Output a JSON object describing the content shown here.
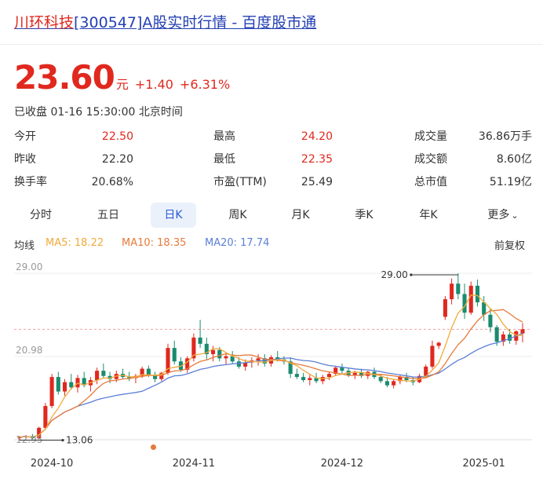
{
  "title": {
    "prefix": "川环科技",
    "code": "[300547]",
    "suffix": "A股实时行情 - 百度股市通"
  },
  "quote": {
    "price": "23.60",
    "unit": "元",
    "change": "+1.40",
    "change_pct": "+6.31%",
    "status": "已收盘 01-16 15:30:00 北京时间"
  },
  "stats": [
    {
      "label": "今开",
      "value": "22.50",
      "color": "red"
    },
    {
      "label": "最高",
      "value": "24.20",
      "color": "red"
    },
    {
      "label": "成交量",
      "value": "36.86万手",
      "color": "normal"
    },
    {
      "label": "昨收",
      "value": "22.20",
      "color": "normal"
    },
    {
      "label": "最低",
      "value": "22.35",
      "color": "red"
    },
    {
      "label": "成交额",
      "value": "8.60亿",
      "color": "normal"
    },
    {
      "label": "换手率",
      "value": "20.68%",
      "color": "normal"
    },
    {
      "label": "市盈(TTM)",
      "value": "25.49",
      "color": "normal"
    },
    {
      "label": "总市值",
      "value": "51.19亿",
      "color": "normal"
    }
  ],
  "tabs": [
    "分时",
    "五日",
    "日K",
    "周K",
    "月K",
    "季K",
    "年K",
    "更多"
  ],
  "active_tab": "日K",
  "ma": {
    "label": "均线",
    "ma5": "MA5: 18.22",
    "ma10": "MA10: 18.35",
    "ma20": "MA20: 17.74",
    "adjust": "前复权"
  },
  "colors": {
    "up": "#e0281e",
    "down": "#1a8b6e",
    "ma5": "#f2a93b",
    "ma10": "#e77a3a",
    "ma20": "#5b7fd6",
    "accent": "#2c5bd6"
  },
  "chart_data": {
    "type": "candlestick",
    "title": "",
    "y_ticks": [
      "29.00",
      "20.98",
      "12.95"
    ],
    "ylim": [
      12.95,
      29.0
    ],
    "x_ticks": [
      "2024-10",
      "2024-11",
      "2024-12",
      "2025-01"
    ],
    "max_label": "29.00",
    "min_label": "13.06",
    "last_close": 23.6,
    "candles": [
      [
        13.1,
        13.3,
        12.9,
        13.2
      ],
      [
        13.2,
        13.4,
        13.0,
        13.3
      ],
      [
        13.3,
        13.5,
        13.0,
        13.1
      ],
      [
        13.1,
        14.2,
        13.0,
        14.1
      ],
      [
        14.1,
        16.5,
        13.9,
        16.2
      ],
      [
        16.2,
        19.3,
        16.0,
        19.0
      ],
      [
        19.0,
        19.5,
        17.3,
        17.6
      ],
      [
        17.6,
        18.8,
        17.2,
        18.5
      ],
      [
        18.5,
        19.3,
        17.8,
        18.0
      ],
      [
        18.0,
        19.2,
        17.5,
        18.9
      ],
      [
        18.9,
        19.5,
        18.0,
        18.2
      ],
      [
        18.2,
        19.0,
        17.6,
        18.7
      ],
      [
        18.7,
        19.9,
        18.3,
        19.6
      ],
      [
        19.6,
        20.3,
        18.9,
        19.1
      ],
      [
        19.1,
        19.5,
        18.4,
        18.8
      ],
      [
        18.8,
        19.6,
        18.5,
        19.3
      ],
      [
        19.3,
        19.8,
        18.8,
        19.0
      ],
      [
        19.0,
        19.5,
        18.6,
        18.9
      ],
      [
        18.9,
        19.3,
        18.4,
        19.1
      ],
      [
        19.1,
        20.0,
        18.9,
        19.8
      ],
      [
        19.8,
        20.1,
        19.0,
        19.2
      ],
      [
        19.2,
        19.5,
        18.5,
        18.8
      ],
      [
        18.8,
        19.5,
        18.6,
        19.4
      ],
      [
        19.4,
        22.2,
        19.2,
        21.8
      ],
      [
        21.8,
        22.5,
        20.2,
        20.5
      ],
      [
        20.5,
        20.9,
        19.5,
        19.7
      ],
      [
        19.7,
        21.0,
        19.4,
        20.8
      ],
      [
        20.8,
        23.2,
        20.5,
        22.8
      ],
      [
        22.8,
        24.5,
        21.8,
        22.2
      ],
      [
        22.2,
        22.8,
        20.7,
        21.2
      ],
      [
        21.2,
        22.0,
        20.5,
        21.6
      ],
      [
        21.6,
        21.9,
        20.5,
        20.8
      ],
      [
        20.8,
        21.3,
        20.2,
        21.0
      ],
      [
        21.0,
        21.5,
        20.3,
        20.5
      ],
      [
        20.5,
        20.9,
        19.8,
        20.0
      ],
      [
        20.0,
        20.7,
        19.6,
        20.4
      ],
      [
        20.4,
        20.9,
        19.9,
        20.6
      ],
      [
        20.6,
        21.2,
        20.1,
        20.8
      ],
      [
        20.8,
        21.2,
        20.0,
        20.3
      ],
      [
        20.3,
        21.1,
        20.0,
        20.9
      ],
      [
        20.9,
        21.5,
        20.5,
        20.7
      ],
      [
        20.7,
        21.0,
        20.2,
        20.5
      ],
      [
        20.5,
        20.9,
        18.9,
        19.3
      ],
      [
        19.3,
        19.8,
        18.8,
        19.0
      ],
      [
        19.0,
        19.4,
        18.5,
        18.7
      ],
      [
        18.7,
        19.2,
        18.2,
        18.9
      ],
      [
        18.9,
        19.4,
        18.4,
        18.6
      ],
      [
        18.6,
        19.2,
        18.3,
        19.0
      ],
      [
        19.0,
        19.5,
        18.7,
        19.3
      ],
      [
        19.3,
        20.0,
        19.1,
        19.9
      ],
      [
        19.9,
        20.3,
        19.3,
        19.6
      ],
      [
        19.6,
        19.9,
        19.0,
        19.2
      ],
      [
        19.2,
        19.6,
        18.8,
        19.4
      ],
      [
        19.4,
        19.8,
        18.9,
        19.1
      ],
      [
        19.1,
        19.6,
        18.8,
        19.5
      ],
      [
        19.5,
        19.9,
        18.8,
        19.0
      ],
      [
        19.0,
        19.3,
        18.4,
        18.6
      ],
      [
        18.6,
        19.0,
        18.0,
        18.2
      ],
      [
        18.2,
        18.8,
        17.9,
        18.6
      ],
      [
        18.6,
        19.2,
        18.3,
        19.0
      ],
      [
        19.0,
        19.4,
        18.5,
        18.7
      ],
      [
        18.7,
        19.0,
        18.2,
        18.5
      ],
      [
        18.5,
        19.3,
        18.4,
        19.1
      ],
      [
        19.1,
        20.2,
        18.9,
        20.0
      ],
      [
        20.0,
        22.5,
        19.8,
        22.0
      ],
      [
        22.0,
        22.4,
        21.7,
        22.3
      ],
      [
        24.8,
        26.8,
        24.5,
        26.5
      ],
      [
        26.5,
        28.5,
        26.0,
        28.0
      ],
      [
        28.0,
        29.0,
        26.5,
        27.0
      ],
      [
        27.0,
        28.0,
        24.6,
        25.2
      ],
      [
        25.2,
        28.2,
        25.0,
        27.8
      ],
      [
        27.8,
        28.4,
        25.8,
        26.2
      ],
      [
        26.2,
        26.8,
        24.4,
        25.0
      ],
      [
        25.0,
        25.6,
        23.3,
        23.8
      ],
      [
        23.8,
        24.0,
        22.0,
        22.4
      ],
      [
        22.4,
        23.4,
        22.0,
        23.1
      ],
      [
        23.1,
        23.6,
        22.2,
        22.5
      ],
      [
        22.5,
        23.5,
        22.1,
        23.4
      ],
      [
        23.2,
        24.2,
        22.35,
        23.6
      ]
    ]
  }
}
